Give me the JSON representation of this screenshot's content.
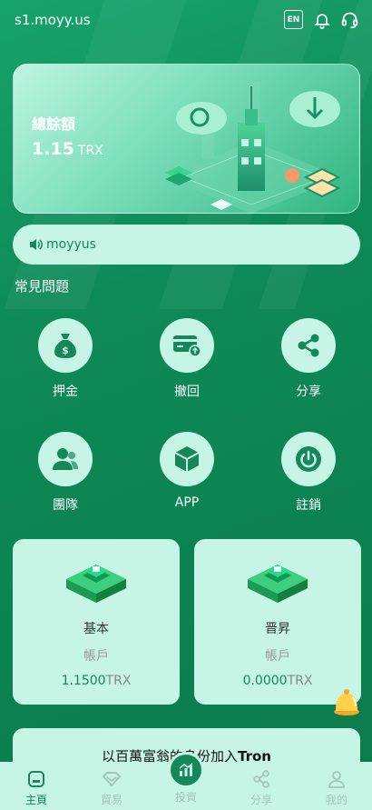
{
  "header": {
    "site": "s1.moyy.us",
    "lang": "EN"
  },
  "balance": {
    "label": "總餘額",
    "amount": "1.15",
    "unit": "TRX"
  },
  "notice": {
    "text": "moyyus"
  },
  "faq": {
    "title": "常見問題",
    "items": [
      {
        "label": "押金",
        "icon": "money-bag-icon"
      },
      {
        "label": "撤回",
        "icon": "card-withdraw-icon"
      },
      {
        "label": "分享",
        "icon": "share-icon"
      },
      {
        "label": "團隊",
        "icon": "team-icon"
      },
      {
        "label": "APP",
        "icon": "cube-icon"
      },
      {
        "label": "註銷",
        "icon": "power-icon"
      }
    ]
  },
  "accounts": [
    {
      "name": "基本",
      "sub": "帳戶",
      "balance": "1.1500",
      "unit": "TRX"
    },
    {
      "name": "晋昇",
      "sub": "帳戶",
      "balance": "0.0000",
      "unit": "TRX"
    }
  ],
  "join": {
    "prefix": "以百萬富翁的身份加入",
    "brand": "Tron"
  },
  "nav": [
    {
      "label": "主頁",
      "icon": "home-icon",
      "active": true
    },
    {
      "label": "貿易",
      "icon": "diamond-icon",
      "active": false
    },
    {
      "label": "投資",
      "icon": "chart-icon",
      "active": false
    },
    {
      "label": "分享",
      "icon": "share-icon",
      "active": false
    },
    {
      "label": "我的",
      "icon": "user-icon",
      "active": false
    }
  ],
  "colors": {
    "background": "#0e8a58",
    "card": "#c6f5e6",
    "accent": "#15875a"
  }
}
